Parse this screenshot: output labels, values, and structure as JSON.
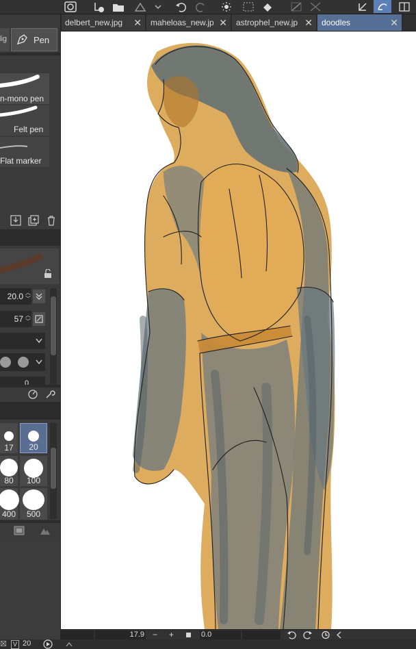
{
  "tabs": [
    {
      "label": "delbert_new.jpg",
      "close": "✕",
      "active": false
    },
    {
      "label": "maheloas_new.jp",
      "close": "✕",
      "active": false
    },
    {
      "label": "astrophel_new.jp",
      "close": "✕",
      "active": false
    },
    {
      "label": "doodles",
      "close": "✕",
      "active": true
    }
  ],
  "tool_panel": {
    "tab_left_partial": "lig",
    "tab_pen": "Pen",
    "brushes": [
      {
        "label": "n-mono pen"
      },
      {
        "label": "Felt pen"
      },
      {
        "label": "Flat marker"
      }
    ]
  },
  "tool_property": {
    "brush_size_value": "20.0",
    "opacity_value": "57",
    "partial_value": "0"
  },
  "brush_size_palette": {
    "sizes": [
      "17",
      "20",
      "80",
      "100",
      "400",
      "500"
    ],
    "selected": "20"
  },
  "navigator": {
    "zoom_value": "17.9",
    "minus": "−",
    "plus": "+",
    "rotation_value": "0.0"
  },
  "statusbar": {
    "label": "V",
    "value": "20"
  },
  "colors": {
    "accent": "#5c7fb8",
    "panel": "#3a3a3a",
    "skin": "#d99a3a",
    "cloth": "#6e7e86"
  }
}
